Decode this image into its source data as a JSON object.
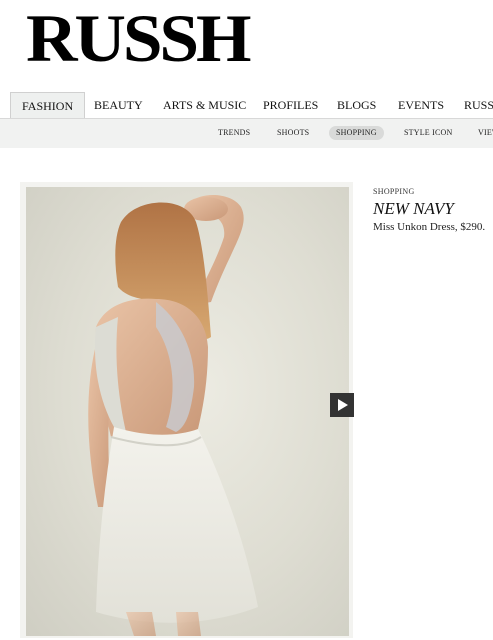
{
  "brand": {
    "logo_text": "RUSSH"
  },
  "nav": {
    "items": [
      {
        "label": "FASHION",
        "active": true
      },
      {
        "label": "BEAUTY"
      },
      {
        "label": "ARTS & MUSIC"
      },
      {
        "label": "PROFILES"
      },
      {
        "label": "BLOGS"
      },
      {
        "label": "EVENTS"
      },
      {
        "label": "RUSSH"
      }
    ]
  },
  "subnav": {
    "items": [
      {
        "label": "TRENDS"
      },
      {
        "label": "SHOOTS"
      },
      {
        "label": "SHOPPING",
        "active": true
      },
      {
        "label": "STYLE ICON"
      },
      {
        "label": "VIEW"
      }
    ]
  },
  "article": {
    "category": "SHOPPING",
    "title": "NEW NAVY",
    "caption": "Miss Unkon Dress, $290."
  },
  "media": {
    "play_icon": "play-icon"
  }
}
